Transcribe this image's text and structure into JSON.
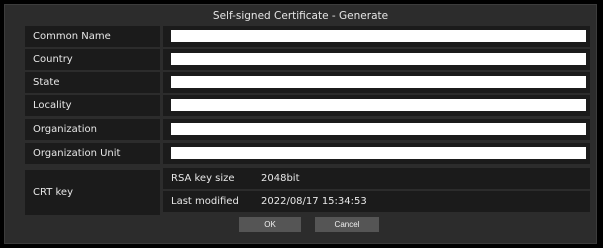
{
  "dialog": {
    "title": "Self-signed Certificate - Generate",
    "fields": [
      {
        "label": "Common Name",
        "value": ""
      },
      {
        "label": "Country",
        "value": ""
      },
      {
        "label": "State",
        "value": ""
      },
      {
        "label": "Locality",
        "value": ""
      },
      {
        "label": "Organization",
        "value": ""
      },
      {
        "label": "Organization Unit",
        "value": ""
      }
    ],
    "crt_key": {
      "label": "CRT key",
      "rsa_key_size_label": "RSA key size",
      "rsa_key_size_value": "2048bit",
      "last_modified_label": "Last modified",
      "last_modified_value": "2022/08/17 15:34:53"
    },
    "buttons": {
      "ok": "OK",
      "cancel": "Cancel"
    }
  }
}
